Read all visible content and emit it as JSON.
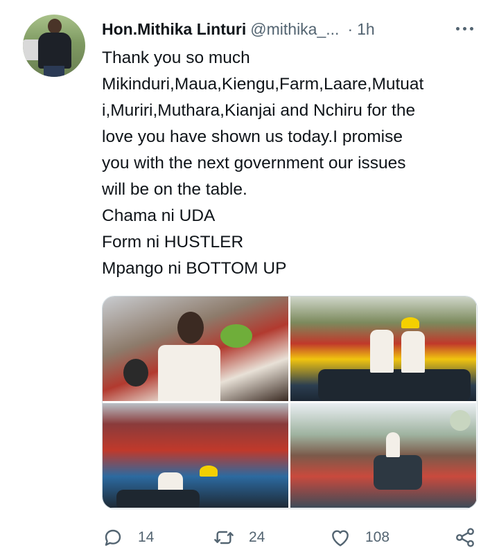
{
  "tweet": {
    "author_name": "Hon.Mithika Linturi",
    "handle": "@mithika_...",
    "separator": "·",
    "time": "1h",
    "text_lines": [
      "Thank you so much",
      "Mikinduri,Maua,Kiengu,Farm,Laare,Mutuat",
      "i,Muriri,Muthara,Kianjai and Nchiru for the",
      "love you have shown us today.I  promise",
      "you with the next government our issues",
      "will be on the table.",
      "Chama ni UDA",
      "Form ni HUSTLER",
      "Mpango ni BOTTOM UP"
    ]
  },
  "actions": {
    "replies": "14",
    "retweets": "24",
    "likes": "108"
  },
  "icons": {
    "more": "more-horizontal-icon",
    "reply": "reply-icon",
    "retweet": "retweet-icon",
    "like": "heart-icon",
    "share": "share-icon"
  },
  "colors": {
    "text": "#0f1419",
    "secondary": "#536471",
    "border": "#cfd9de"
  }
}
